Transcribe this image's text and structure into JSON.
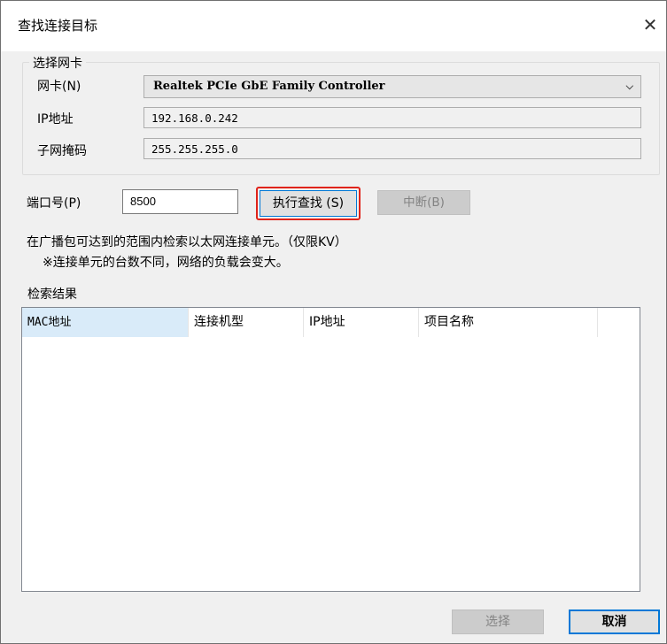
{
  "window": {
    "title": "查找连接目标",
    "close_glyph": "✕"
  },
  "nic_group": {
    "label": "选择网卡",
    "nic_label": "网卡(N)",
    "nic_value": "Realtek PCIe GbE Family Controller",
    "ip_label": "IP地址",
    "ip_value": "192.168.0.242",
    "mask_label": "子网掩码",
    "mask_value": "255.255.255.0"
  },
  "port": {
    "label": "端口号(P)",
    "value": "8500"
  },
  "buttons": {
    "search": "执行查找 (S)",
    "abort": "中断(B)",
    "select": "选择",
    "cancel": "取消"
  },
  "info": {
    "line1": "在广播包可达到的范围内检索以太网连接单元。（仅限KV）",
    "line2": "※连接单元的台数不同，网络的负载会变大。"
  },
  "results": {
    "label": "检索结果",
    "columns": [
      "MAC地址",
      "连接机型",
      "IP地址",
      "项目名称"
    ],
    "rows": []
  },
  "icons": {
    "dropdown": "chevron-down-icon",
    "close": "close-icon"
  },
  "colors": {
    "highlight": "#e0231a",
    "accent": "#0078d7",
    "selected_header": "#d9ebf9"
  }
}
